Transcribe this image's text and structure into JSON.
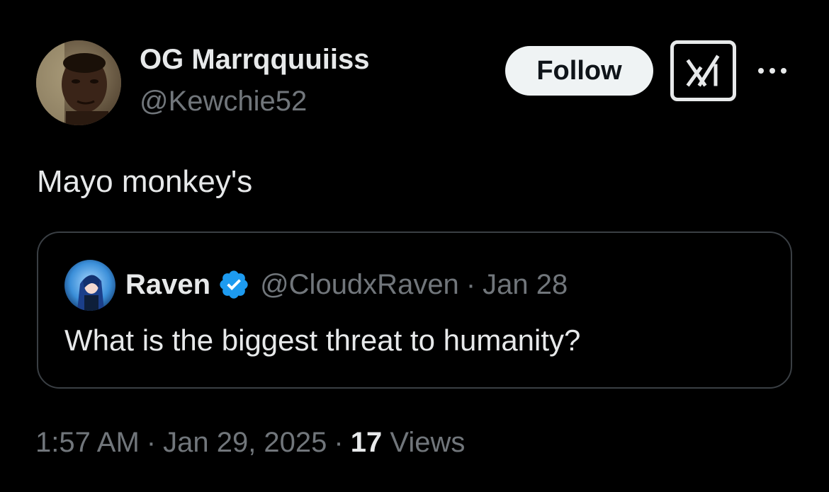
{
  "author": {
    "display_name": "OG Marrqquuiiss",
    "handle": "@Kewchie52"
  },
  "actions": {
    "follow_label": "Follow",
    "grok_icon": "grok-logo-icon",
    "more_icon": "more-horizontal-icon"
  },
  "tweet": {
    "text": "Mayo monkey's"
  },
  "quote": {
    "name": "Raven",
    "verified_icon": "verified-badge-icon",
    "handle": "@CloudxRaven",
    "separator": "·",
    "date": "Jan 28",
    "text": "What is the biggest threat to humanity?"
  },
  "meta": {
    "time": "1:57 AM",
    "separator": "·",
    "date": "Jan 29, 2025",
    "views_count": "17",
    "views_label": "Views"
  },
  "colors": {
    "background": "#000000",
    "primary_text": "#e7e9ea",
    "secondary_text": "#71767b",
    "border": "#3a3f44",
    "verified": "#1d9bf0",
    "follow_bg": "#eff3f4"
  }
}
